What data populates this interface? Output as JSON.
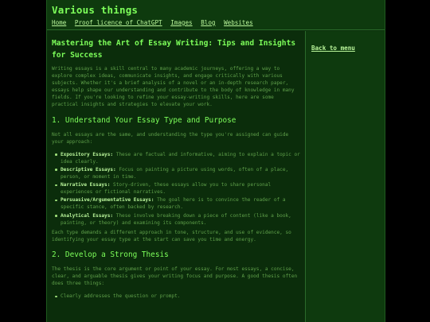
{
  "site": {
    "title": "Various things",
    "nav": [
      "Home",
      "Proof licence of ChatGPT",
      "Images",
      "Blog",
      "Websites"
    ]
  },
  "sidebar": {
    "back_link": "Back to menu"
  },
  "article": {
    "title": "Mastering the Art of Essay Writing: Tips and Insights for Success",
    "intro": "Writing essays is a skill central to many academic journeys, offering a way to explore complex ideas, communicate insights, and engage critically with various subjects. Whether it's a brief analysis of a novel or an in-depth research paper, essays help shape our understanding and contribute to the body of knowledge in many fields. If you're looking to refine your essay-writing skills, here are some practical insights and strategies to elevate your work.",
    "sections": [
      {
        "heading": "1. Understand Your Essay Type and Purpose",
        "lead": "Not all essays are the same, and understanding the type you're assigned can guide your approach:",
        "items": [
          {
            "term": "Expository Essays",
            "text": "These are factual and informative, aiming to explain a topic or idea clearly."
          },
          {
            "term": "Descriptive Essays",
            "text": "Focus on painting a picture using words, often of a place, person, or moment in time."
          },
          {
            "term": "Narrative Essays",
            "text": "Story-driven, these essays allow you to share personal experiences or fictional narratives."
          },
          {
            "term": "Persuasive/Argumentative Essays",
            "text": "The goal here is to convince the reader of a specific stance, often backed by research."
          },
          {
            "term": "Analytical Essays",
            "text": "These involve breaking down a piece of content (like a book, painting, or theory) and examining its components."
          }
        ],
        "closing": "Each type demands a different approach in tone, structure, and use of evidence, so identifying your essay type at the start can save you time and energy."
      },
      {
        "heading": "2. Develop a Strong Thesis",
        "lead": "The thesis is the core argument or point of your essay. For most essays, a concise, clear, and arguable thesis gives your writing focus and purpose. A good thesis often does three things:",
        "items": [
          {
            "term": "",
            "text": "Clearly addresses the question or prompt."
          }
        ]
      }
    ]
  }
}
